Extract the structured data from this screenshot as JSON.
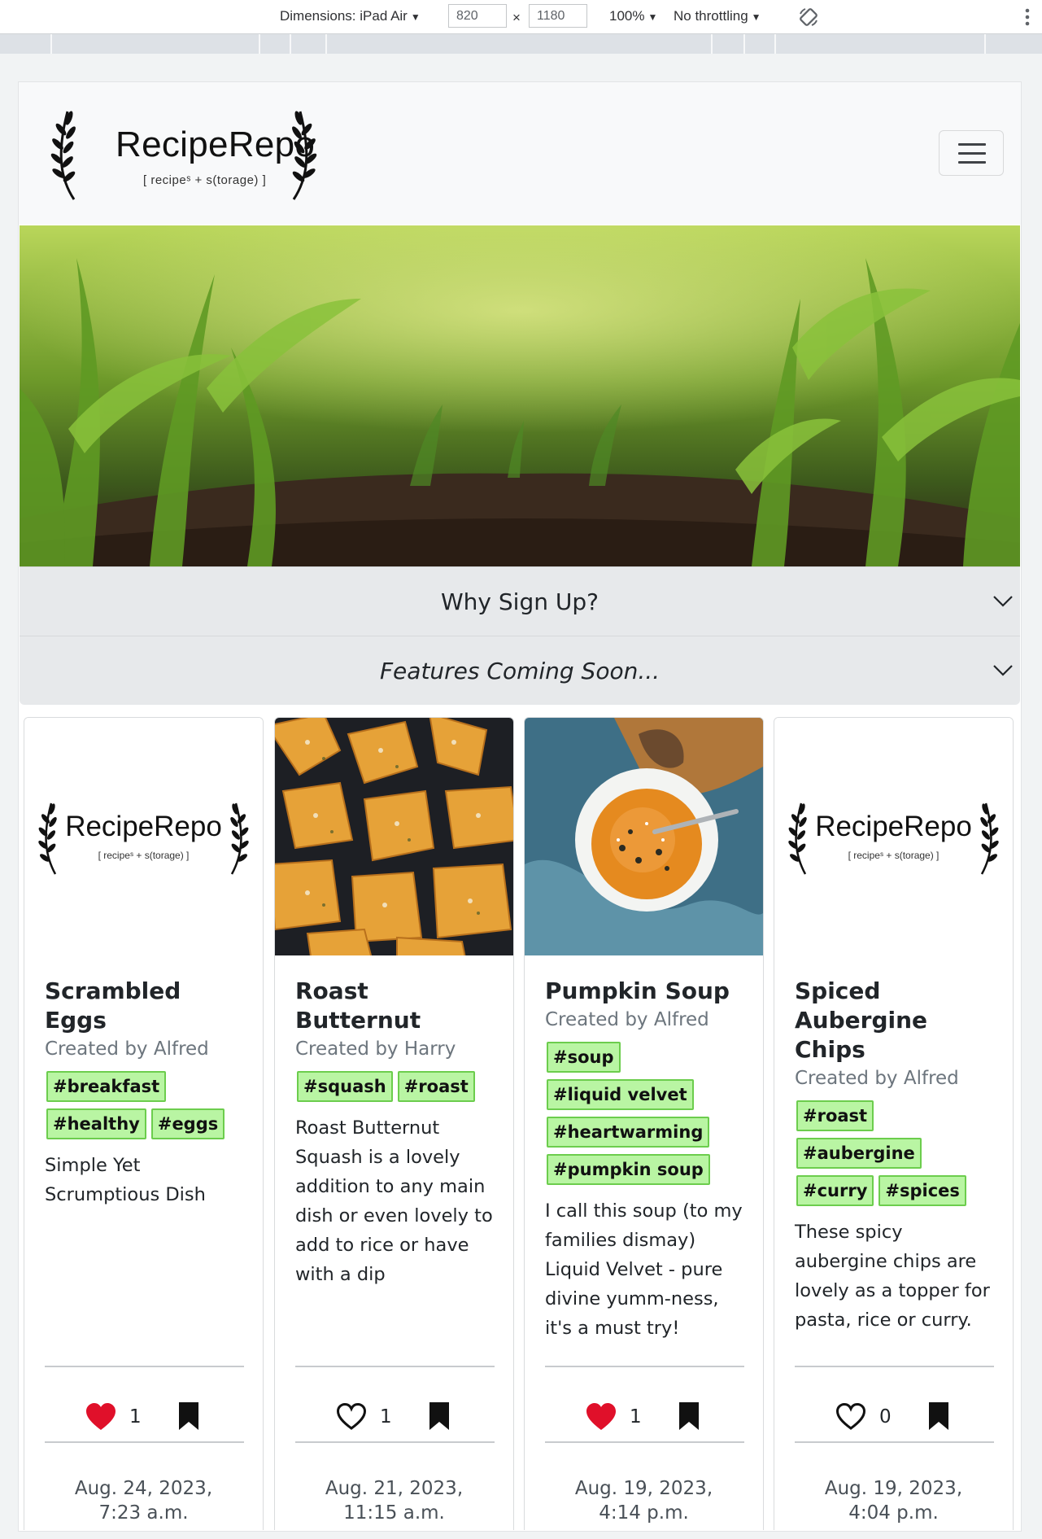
{
  "devtools": {
    "dimensions_label": "Dimensions: iPad Air",
    "width": "820",
    "times": "×",
    "height": "1180",
    "zoom": "100%",
    "throttling": "No throttling",
    "rotate_icon": "rotate-icon",
    "more_icon": "more-vert-icon"
  },
  "navbar": {
    "brand": "RecipeRepo",
    "brand_sub": "[ recipeˢ + s(torage) ]",
    "toggler_icon": "hamburger-icon"
  },
  "accordion": [
    {
      "title": "Why Sign Up?",
      "icon": "chevron-down-icon"
    },
    {
      "title": "Features Coming Soon...",
      "icon": "chevron-down-icon"
    }
  ],
  "cards": [
    {
      "image": "recipe-repo-logo",
      "title": "Scrambled Eggs",
      "author": "Created by Alfred",
      "tags": [
        "#breakfast",
        "#healthy",
        "#eggs"
      ],
      "description": "Simple Yet Scrumptious Dish",
      "liked": true,
      "likes": "1",
      "date": "Aug. 24, 2023, 7:23 a.m."
    },
    {
      "image": "roast-butternut-photo",
      "title": "Roast Butternut",
      "author": "Created by Harry",
      "tags": [
        "#squash",
        "#roast"
      ],
      "description": "Roast Butternut Squash is a lovely addition to any main dish or even lovely to add to rice or have with a dip",
      "liked": false,
      "likes": "1",
      "date": "Aug. 21, 2023, 11:15 a.m."
    },
    {
      "image": "pumpkin-soup-photo",
      "title": "Pumpkin Soup",
      "author": "Created by Alfred",
      "tags": [
        "#soup",
        "#liquid velvet",
        "#heartwarming",
        "#pumpkin soup"
      ],
      "description": "I call this soup (to my families dismay) Liquid Velvet - pure divine yumm-ness, it's a must try!",
      "liked": true,
      "likes": "1",
      "date": "Aug. 19, 2023, 4:14 p.m."
    },
    {
      "image": "recipe-repo-logo",
      "title": "Spiced Aubergine Chips",
      "author": "Created by Alfred",
      "tags": [
        "#roast",
        "#aubergine",
        "#curry",
        "#spices"
      ],
      "description": "These spicy aubergine chips are lovely as a topper for pasta, rice or curry.",
      "liked": false,
      "likes": "0",
      "date": "Aug. 19, 2023, 4:04 p.m."
    }
  ],
  "colors": {
    "heart": "#e0102a",
    "tag_bg": "#b9f5a3",
    "tag_border": "#6ccd4d",
    "accordion_bg": "#e7e9eb"
  }
}
